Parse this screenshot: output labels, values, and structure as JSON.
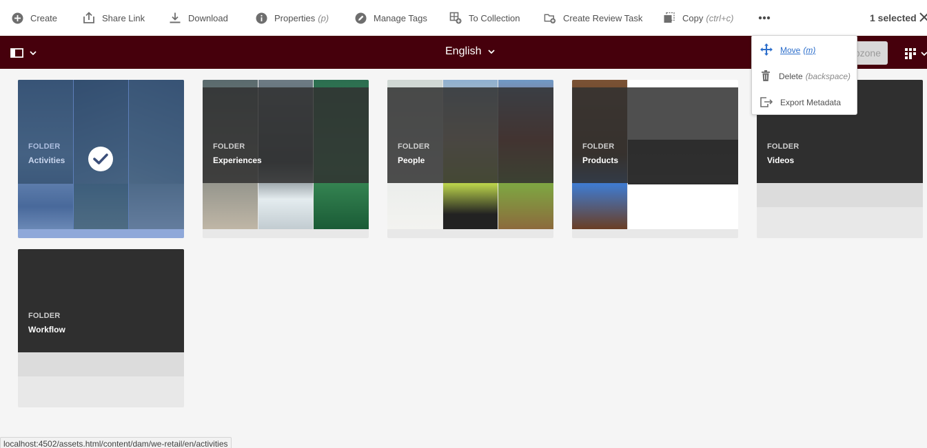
{
  "actionbar": {
    "create": "Create",
    "share_link": "Share Link",
    "download": "Download",
    "properties": "Properties",
    "properties_shortcut": "(p)",
    "manage_tags": "Manage Tags",
    "to_collection": "To Collection",
    "create_review_task": "Create Review Task",
    "copy": "Copy",
    "copy_shortcut": "(ctrl+c)",
    "selected_count": "1 selected"
  },
  "header": {
    "title": "English",
    "dropzone_label": "ropzone"
  },
  "more_menu": {
    "items": [
      {
        "label": "Move",
        "shortcut": "(m)",
        "icon": "move-icon"
      },
      {
        "label": "Delete",
        "shortcut": "(backspace)",
        "icon": "trash-icon"
      },
      {
        "label": "Export Metadata",
        "shortcut": "",
        "icon": "export-icon"
      }
    ]
  },
  "folders": [
    {
      "type": "FOLDER",
      "name": "Activities",
      "selected": true
    },
    {
      "type": "FOLDER",
      "name": "Experiences",
      "selected": false
    },
    {
      "type": "FOLDER",
      "name": "People",
      "selected": false
    },
    {
      "type": "FOLDER",
      "name": "Products",
      "selected": false
    },
    {
      "type": "FOLDER",
      "name": "Videos",
      "selected": false
    },
    {
      "type": "FOLDER",
      "name": "Workflow",
      "selected": false
    }
  ],
  "status_url": "localhost:4502/assets.html/content/dam/we-retail/en/activities",
  "colors": {
    "header_bg": "#46000c",
    "selection_blue": "#365ca0",
    "link_blue": "#2c6ecb"
  }
}
